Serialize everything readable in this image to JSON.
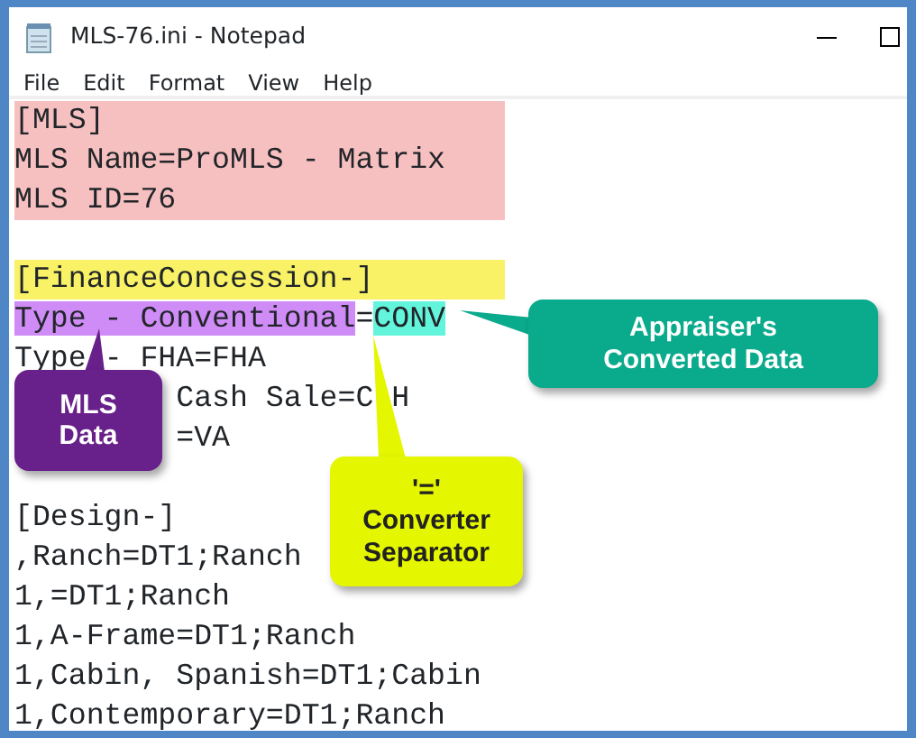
{
  "window": {
    "title": "MLS-76.ini - Notepad"
  },
  "menu": [
    "File",
    "Edit",
    "Format",
    "View",
    "Help"
  ],
  "sections": [
    {
      "lines": [
        {
          "segments": [
            {
              "text": "[MLS]"
            }
          ],
          "color": "#f7c0c0"
        },
        {
          "segments": [
            {
              "text": "MLS Name=ProMLS - Matrix"
            }
          ],
          "color": "#f7c0c0"
        },
        {
          "segments": [
            {
              "text": "MLS ID=76"
            }
          ],
          "color": "#f7c0c0"
        }
      ]
    },
    {
      "lines": [
        {
          "segments": [
            {
              "text": "[FinanceConcession-]"
            }
          ],
          "color": "#f9f266"
        },
        {
          "segments": [
            {
              "text": "Type - Conventional",
              "color": "#d08cf6"
            },
            {
              "text": "="
            },
            {
              "text": "CONV",
              "color": "#62f5dc"
            }
          ]
        },
        {
          "segments": [
            {
              "text": "Type"
            },
            {
              "text": " - FHA=FHA"
            }
          ]
        },
        {
          "segments": [
            {
              "text": "         Cash Sale=C"
            },
            {
              "text": " H"
            }
          ]
        },
        {
          "segments": [
            {
              "text": "         =VA"
            }
          ]
        }
      ]
    },
    {
      "lines": [
        {
          "segments": [
            {
              "text": "[Design-]"
            }
          ]
        },
        {
          "segments": [
            {
              "text": ",Ranch=DT1;Ranch"
            }
          ]
        },
        {
          "segments": [
            {
              "text": "1,=DT1;Ranch"
            }
          ]
        },
        {
          "segments": [
            {
              "text": "1,A-Frame=DT1;Ranch"
            }
          ]
        },
        {
          "segments": [
            {
              "text": "1,Cabin, Spanish=DT1;Cabin"
            }
          ]
        },
        {
          "segments": [
            {
              "text": "1,Contemporary=DT1;Ranch"
            }
          ]
        }
      ]
    }
  ],
  "callouts": [
    {
      "kind": "purple",
      "lines": [
        "MLS",
        "Data"
      ],
      "color": "#68208a"
    },
    {
      "kind": "teal",
      "lines": [
        "Appraiser's",
        "Converted Data"
      ],
      "color": "#0aaa8c"
    },
    {
      "kind": "yellow",
      "lines": [
        "'='",
        "Converter",
        "Separator"
      ],
      "color": "#e4f600"
    }
  ]
}
